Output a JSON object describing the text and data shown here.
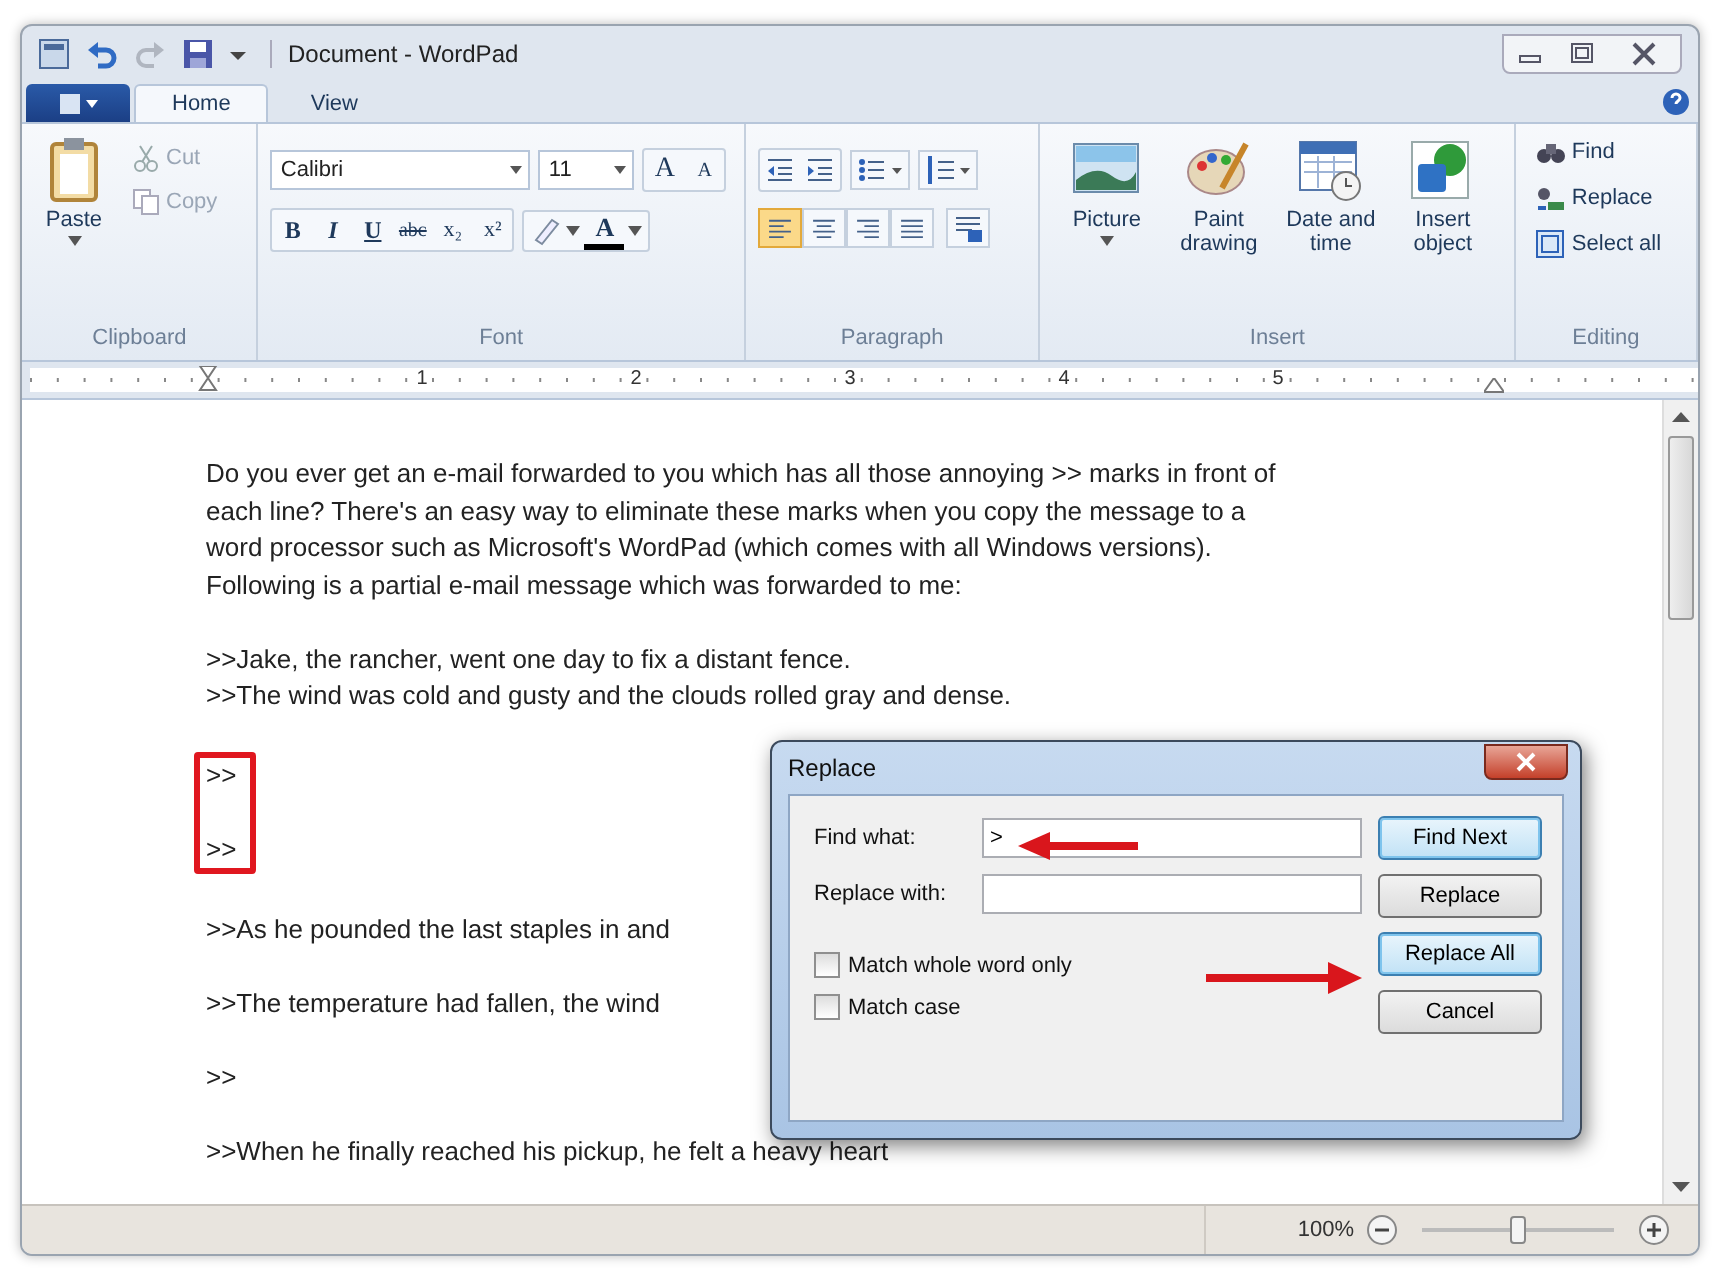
{
  "window": {
    "title": "Document - WordPad"
  },
  "ribbon_tabs": [
    {
      "label": "Home",
      "selected": true
    },
    {
      "label": "View",
      "selected": false
    }
  ],
  "clipboard": {
    "paste": "Paste",
    "cut": "Cut",
    "copy": "Copy",
    "label": "Clipboard"
  },
  "font": {
    "family": "Calibri",
    "size": "11",
    "grow": "A",
    "shrink": "A",
    "format_buttons": [
      "B",
      "I",
      "U",
      "abc",
      "x₂",
      "x²"
    ],
    "color_button": "A",
    "label": "Font"
  },
  "paragraph": {
    "align_buttons": [
      {
        "kind": "left",
        "selected": true
      },
      {
        "kind": "center",
        "selected": false
      },
      {
        "kind": "right",
        "selected": false
      },
      {
        "kind": "justify",
        "selected": false
      }
    ],
    "label": "Paragraph"
  },
  "insert": {
    "items": [
      {
        "kind": "picture",
        "label": "Picture"
      },
      {
        "kind": "paint",
        "label": "Paint drawing"
      },
      {
        "kind": "date",
        "label": "Date and time"
      },
      {
        "kind": "object",
        "label": "Insert object"
      }
    ],
    "label": "Insert"
  },
  "editing": {
    "items": [
      {
        "kind": "find",
        "label": "Find"
      },
      {
        "kind": "replace",
        "label": "Replace"
      },
      {
        "kind": "select",
        "label": "Select all"
      }
    ],
    "label": "Editing"
  },
  "ruler": {
    "numbers": [
      "1",
      "2",
      "3",
      "4",
      "5"
    ]
  },
  "document": {
    "blocks": [
      {
        "marked": false,
        "lines": [
          "Do you ever get an e-mail forwarded to you which has all those annoying >> marks in front of",
          "each line? There's an easy way to eliminate these marks when you copy the message to a",
          "word processor such as Microsoft's WordPad (which comes with all Windows versions).",
          "Following is a partial e-mail message which was forwarded to me:"
        ]
      },
      {
        "marked": false,
        "lines": [
          ">>Jake, the rancher, went one day to fix a distant fence.",
          ">>The wind was cold and gusty and the clouds rolled gray and dense."
        ]
      },
      {
        "marked": true,
        "lines": [
          ">>",
          ">>"
        ]
      },
      {
        "marked": false,
        "lines": [
          ">>As he pounded the last staples in and"
        ]
      },
      {
        "marked": false,
        "lines": [
          ">>The temperature had fallen, the wind"
        ]
      },
      {
        "marked": false,
        "lines": [
          ">>"
        ]
      },
      {
        "marked": false,
        "lines": [
          ">>When he finally reached his pickup, he felt a heavy heart"
        ]
      }
    ]
  },
  "dialog": {
    "title": "Replace",
    "fields": [
      {
        "label": "Find what:",
        "value": ">"
      },
      {
        "label": "Replace with:"
      }
    ],
    "checkboxes": [
      {
        "label": "Match whole word only",
        "checked": false
      },
      {
        "label": "Match case",
        "checked": false
      }
    ],
    "buttons": [
      {
        "label": "Find Next",
        "highlighted": true
      },
      {
        "label": "Replace",
        "highlighted": false
      },
      {
        "label": "Replace All",
        "highlighted": true
      },
      {
        "label": "Cancel",
        "highlighted": false
      }
    ]
  },
  "status_bar": {
    "zoom": "100%",
    "level": 0.5
  }
}
